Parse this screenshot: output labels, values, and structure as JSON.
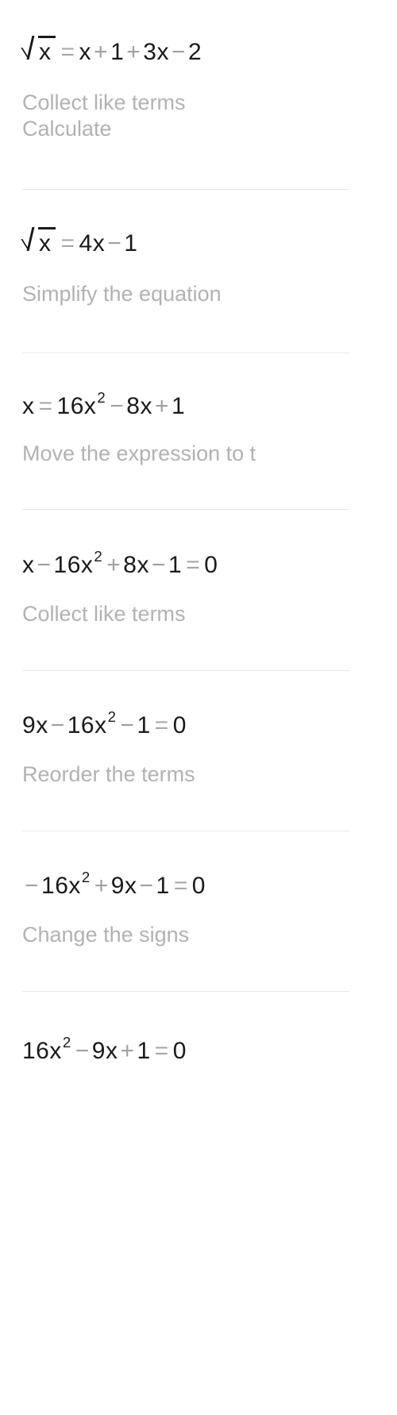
{
  "app": {
    "title": "Equation step-by-step solution",
    "background_color": "#ffffff",
    "operand_color": "#1a1a1a",
    "operator_color": "#a0a0a0",
    "hint_color": "#b2b2b2",
    "divider_color": "#e9e9e9"
  },
  "steps": [
    {
      "id": "step-1",
      "equation": {
        "parts": [
          {
            "kind": "sqrt",
            "radicand": "x"
          },
          {
            "kind": "eq",
            "text": "="
          },
          {
            "kind": "var",
            "text": "x"
          },
          {
            "kind": "op",
            "text": "+"
          },
          {
            "kind": "num",
            "text": "1"
          },
          {
            "kind": "op",
            "text": "+"
          },
          {
            "kind": "num",
            "text": "3"
          },
          {
            "kind": "var",
            "text": "x"
          },
          {
            "kind": "op",
            "text": "−"
          },
          {
            "kind": "num",
            "text": "2"
          }
        ],
        "plain": "√x = x + 1 + 3x − 2"
      },
      "hints": [
        "Collect like terms",
        "Calculate"
      ]
    },
    {
      "id": "step-2",
      "equation": {
        "parts": [
          {
            "kind": "sqrt",
            "radicand": "x"
          },
          {
            "kind": "eq",
            "text": "="
          },
          {
            "kind": "num",
            "text": "4"
          },
          {
            "kind": "var",
            "text": "x"
          },
          {
            "kind": "op",
            "text": "−"
          },
          {
            "kind": "num",
            "text": "1"
          }
        ],
        "plain": "√x = 4x − 1"
      },
      "hints": [
        "Simplify the equation"
      ]
    },
    {
      "id": "step-3",
      "equation": {
        "parts": [
          {
            "kind": "var",
            "text": "x"
          },
          {
            "kind": "eq",
            "text": "="
          },
          {
            "kind": "num",
            "text": "16"
          },
          {
            "kind": "var",
            "text": "x",
            "sup": "2"
          },
          {
            "kind": "op",
            "text": "−"
          },
          {
            "kind": "num",
            "text": "8"
          },
          {
            "kind": "var",
            "text": "x"
          },
          {
            "kind": "op",
            "text": "+"
          },
          {
            "kind": "num",
            "text": "1"
          }
        ],
        "plain": "x = 16x² − 8x + 1"
      },
      "hints": [
        "Move the expression to t"
      ]
    },
    {
      "id": "step-4",
      "equation": {
        "parts": [
          {
            "kind": "var",
            "text": "x"
          },
          {
            "kind": "op",
            "text": "−"
          },
          {
            "kind": "num",
            "text": "16"
          },
          {
            "kind": "var",
            "text": "x",
            "sup": "2"
          },
          {
            "kind": "op",
            "text": "+"
          },
          {
            "kind": "num",
            "text": "8"
          },
          {
            "kind": "var",
            "text": "x"
          },
          {
            "kind": "op",
            "text": "−"
          },
          {
            "kind": "num",
            "text": "1"
          },
          {
            "kind": "eq",
            "text": "="
          },
          {
            "kind": "num",
            "text": "0"
          }
        ],
        "plain": "x − 16x² + 8x − 1 = 0"
      },
      "hints": [
        "Collect like terms"
      ]
    },
    {
      "id": "step-5",
      "equation": {
        "parts": [
          {
            "kind": "num",
            "text": "9"
          },
          {
            "kind": "var",
            "text": "x"
          },
          {
            "kind": "op",
            "text": "−"
          },
          {
            "kind": "num",
            "text": "16"
          },
          {
            "kind": "var",
            "text": "x",
            "sup": "2"
          },
          {
            "kind": "op",
            "text": "−"
          },
          {
            "kind": "num",
            "text": "1"
          },
          {
            "kind": "eq",
            "text": "="
          },
          {
            "kind": "num",
            "text": "0"
          }
        ],
        "plain": "9x − 16x² − 1 = 0"
      },
      "hints": [
        "Reorder the terms"
      ]
    },
    {
      "id": "step-6",
      "equation": {
        "parts": [
          {
            "kind": "op",
            "text": "−"
          },
          {
            "kind": "num",
            "text": "16"
          },
          {
            "kind": "var",
            "text": "x",
            "sup": "2"
          },
          {
            "kind": "op",
            "text": "+"
          },
          {
            "kind": "num",
            "text": "9"
          },
          {
            "kind": "var",
            "text": "x"
          },
          {
            "kind": "op",
            "text": "−"
          },
          {
            "kind": "num",
            "text": "1"
          },
          {
            "kind": "eq",
            "text": "="
          },
          {
            "kind": "num",
            "text": "0"
          }
        ],
        "plain": "− 16x² + 9x − 1 = 0"
      },
      "hints": [
        "Change the signs"
      ]
    },
    {
      "id": "step-7",
      "equation": {
        "parts": [
          {
            "kind": "num",
            "text": "16"
          },
          {
            "kind": "var",
            "text": "x",
            "sup": "2"
          },
          {
            "kind": "op",
            "text": "−"
          },
          {
            "kind": "num",
            "text": "9"
          },
          {
            "kind": "var",
            "text": "x"
          },
          {
            "kind": "op",
            "text": "+"
          },
          {
            "kind": "num",
            "text": "1"
          },
          {
            "kind": "eq",
            "text": "="
          },
          {
            "kind": "num",
            "text": "0"
          }
        ],
        "plain": "16x² − 9x + 1 = 0"
      },
      "hints": []
    }
  ]
}
